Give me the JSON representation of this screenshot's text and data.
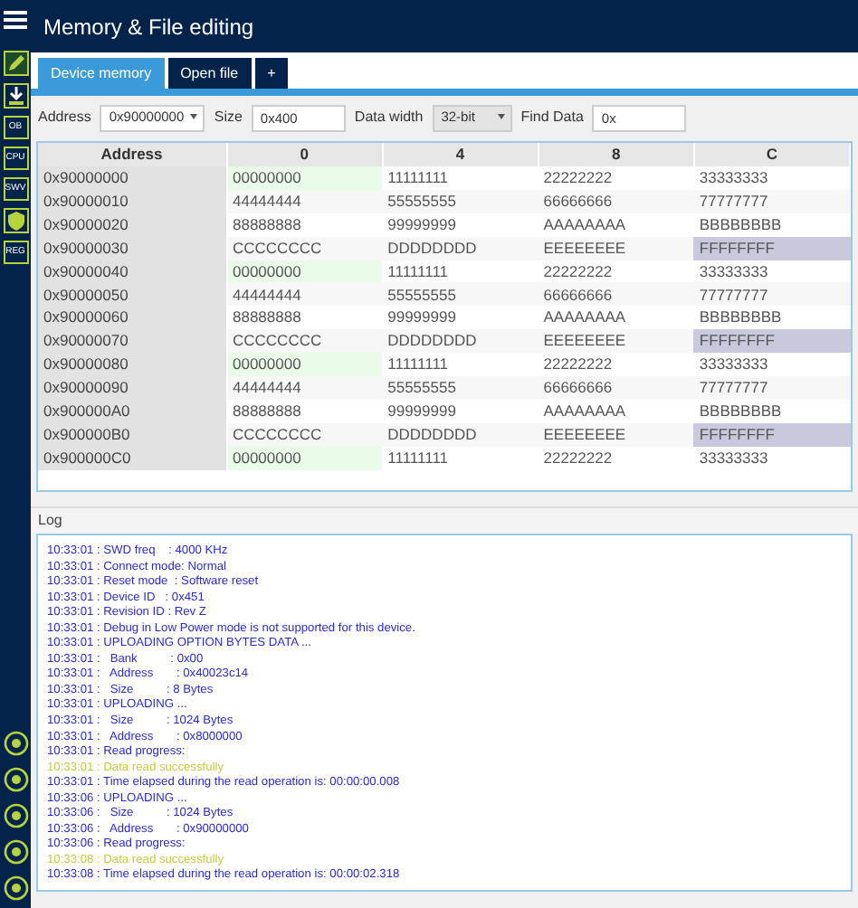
{
  "window": {
    "title": "Memory & File editing"
  },
  "sidebar": {
    "top_items": [
      {
        "kind": "edit",
        "selected": true
      },
      {
        "kind": "download",
        "selected": false
      },
      {
        "kind": "text",
        "label": "OB",
        "selected": false
      },
      {
        "kind": "text",
        "label": "CPU",
        "selected": false
      },
      {
        "kind": "text",
        "label": "SWV",
        "selected": false
      },
      {
        "kind": "shield",
        "selected": false
      },
      {
        "kind": "text",
        "label": "REG",
        "selected": false
      }
    ],
    "bottom_items": [
      {
        "kind": "circle"
      },
      {
        "kind": "circle"
      },
      {
        "kind": "circle"
      },
      {
        "kind": "circle"
      },
      {
        "kind": "circle"
      }
    ]
  },
  "tabs": [
    {
      "label": "Device memory",
      "selected": true
    },
    {
      "label": "Open file",
      "selected": false
    },
    {
      "label": "+",
      "selected": false
    }
  ],
  "controls": {
    "address_label": "Address",
    "address": "0x90000000",
    "size_label": "Size",
    "size": "0x400",
    "width_label": "Data width",
    "width": "32-bit",
    "find_label": "Find Data",
    "find": "0x"
  },
  "table": {
    "columns": [
      "Address",
      "0",
      "4",
      "8",
      "C"
    ],
    "rows": [
      {
        "cells": [
          {
            "text": "0x90000000"
          },
          {
            "text": "00000000",
            "color": "#eafbea"
          },
          {
            "text": "11111111"
          },
          {
            "text": "22222222"
          },
          {
            "text": "33333333"
          }
        ]
      },
      {
        "cells": [
          {
            "text": "0x90000010"
          },
          {
            "text": "44444444"
          },
          {
            "text": "55555555"
          },
          {
            "text": "66666666"
          },
          {
            "text": "77777777"
          }
        ]
      },
      {
        "cells": [
          {
            "text": "0x90000020"
          },
          {
            "text": "88888888"
          },
          {
            "text": "99999999"
          },
          {
            "text": "AAAAAAAA"
          },
          {
            "text": "BBBBBBBB"
          }
        ]
      },
      {
        "cells": [
          {
            "text": "0x90000030"
          },
          {
            "text": "CCCCCCCC"
          },
          {
            "text": "DDDDDDDD"
          },
          {
            "text": "EEEEEEEE"
          },
          {
            "text": "FFFFFFFF",
            "color": "#c9c8dc"
          }
        ]
      },
      {
        "cells": [
          {
            "text": "0x90000040"
          },
          {
            "text": "00000000",
            "color": "#eafbea"
          },
          {
            "text": "11111111"
          },
          {
            "text": "22222222"
          },
          {
            "text": "33333333"
          }
        ]
      },
      {
        "cells": [
          {
            "text": "0x90000050"
          },
          {
            "text": "44444444"
          },
          {
            "text": "55555555"
          },
          {
            "text": "66666666"
          },
          {
            "text": "77777777"
          }
        ]
      },
      {
        "cells": [
          {
            "text": "0x90000060"
          },
          {
            "text": "88888888"
          },
          {
            "text": "99999999"
          },
          {
            "text": "AAAAAAAA"
          },
          {
            "text": "BBBBBBBB"
          }
        ]
      },
      {
        "cells": [
          {
            "text": "0x90000070"
          },
          {
            "text": "CCCCCCCC"
          },
          {
            "text": "DDDDDDDD"
          },
          {
            "text": "EEEEEEEE"
          },
          {
            "text": "FFFFFFFF",
            "color": "#c9c8dc"
          }
        ]
      },
      {
        "cells": [
          {
            "text": "0x90000080"
          },
          {
            "text": "00000000",
            "color": "#eafbea"
          },
          {
            "text": "11111111"
          },
          {
            "text": "22222222"
          },
          {
            "text": "33333333"
          }
        ]
      },
      {
        "cells": [
          {
            "text": "0x90000090"
          },
          {
            "text": "44444444"
          },
          {
            "text": "55555555"
          },
          {
            "text": "66666666"
          },
          {
            "text": "77777777"
          }
        ]
      },
      {
        "cells": [
          {
            "text": "0x900000A0"
          },
          {
            "text": "88888888"
          },
          {
            "text": "99999999"
          },
          {
            "text": "AAAAAAAA"
          },
          {
            "text": "BBBBBBBB"
          }
        ]
      },
      {
        "cells": [
          {
            "text": "0x900000B0"
          },
          {
            "text": "CCCCCCCC"
          },
          {
            "text": "DDDDDDDD"
          },
          {
            "text": "EEEEEEEE"
          },
          {
            "text": "FFFFFFFF",
            "color": "#c9c8dc"
          }
        ]
      },
      {
        "cells": [
          {
            "text": "0x900000C0"
          },
          {
            "text": "00000000",
            "color": "#eafbea"
          },
          {
            "text": "11111111"
          },
          {
            "text": "22222222"
          },
          {
            "text": "33333333"
          }
        ]
      }
    ]
  },
  "log": {
    "title": "Log",
    "lines": [
      {
        "kind": "info",
        "text": "10:33:01 : SWD freq    : 4000 KHz"
      },
      {
        "kind": "info",
        "text": "10:33:01 : Connect mode: Normal"
      },
      {
        "kind": "info",
        "text": "10:33:01 : Reset mode  : Software reset"
      },
      {
        "kind": "info",
        "text": "10:33:01 : Device ID   : 0x451"
      },
      {
        "kind": "info",
        "text": "10:33:01 : Revision ID : Rev Z"
      },
      {
        "kind": "info",
        "text": "10:33:01 : Debug in Low Power mode is not supported for this device."
      },
      {
        "kind": "info",
        "text": "10:33:01 : UPLOADING OPTION BYTES DATA ..."
      },
      {
        "kind": "info",
        "text": "10:33:01 :   Bank          : 0x00"
      },
      {
        "kind": "info",
        "text": "10:33:01 :   Address       : 0x40023c14"
      },
      {
        "kind": "info",
        "text": "10:33:01 :   Size          : 8 Bytes"
      },
      {
        "kind": "info",
        "text": "10:33:01 : UPLOADING ..."
      },
      {
        "kind": "info",
        "text": "10:33:01 :   Size          : 1024 Bytes"
      },
      {
        "kind": "info",
        "text": "10:33:01 :   Address       : 0x8000000"
      },
      {
        "kind": "info",
        "text": "10:33:01 : Read progress:"
      },
      {
        "kind": "success",
        "text": "10:33:01 : Data read successfully"
      },
      {
        "kind": "info",
        "text": "10:33:01 : Time elapsed during the read operation is: 00:00:00.008"
      },
      {
        "kind": "info",
        "text": "10:33:06 : UPLOADING ..."
      },
      {
        "kind": "info",
        "text": "10:33:06 :   Size          : 1024 Bytes"
      },
      {
        "kind": "info",
        "text": "10:33:06 :   Address       : 0x90000000"
      },
      {
        "kind": "info",
        "text": "10:33:06 : Read progress:"
      },
      {
        "kind": "success",
        "text": "10:33:08 : Data read successfully"
      },
      {
        "kind": "info",
        "text": "10:33:08 : Time elapsed during the read operation is: 00:00:02.318"
      }
    ]
  }
}
